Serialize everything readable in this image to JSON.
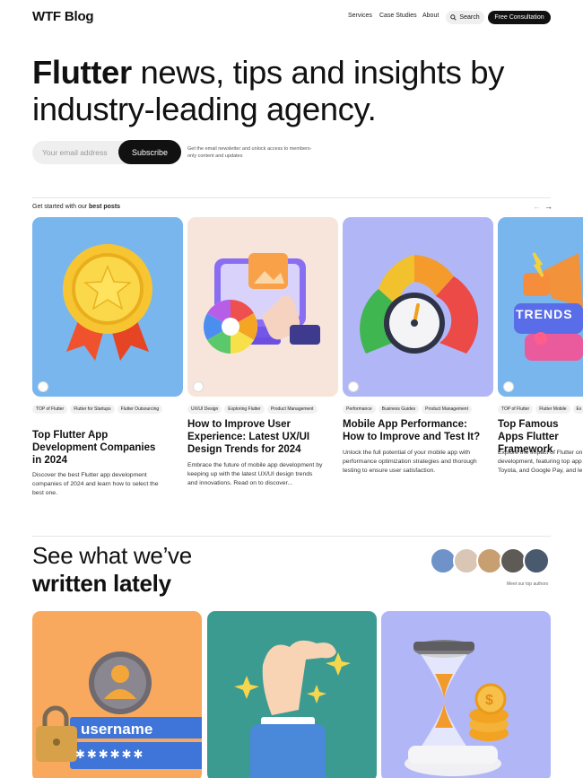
{
  "header": {
    "logo": "WTF Blog",
    "nav": [
      "Services",
      "Case Studies",
      "About"
    ],
    "search_label": "Search",
    "cta_label": "Free Consultation"
  },
  "hero": {
    "title_bold": "Flutter",
    "title_rest": " news, tips and insights by industry-leading agency."
  },
  "newsletter": {
    "email_placeholder": "Your email address",
    "subscribe_label": "Subscribe",
    "note": "Get the email newsletter and unlock access to members-only content and updates"
  },
  "best_posts": {
    "lead_text": "Get started with our ",
    "lead_bold": "best posts",
    "prev_arrow": "←",
    "next_arrow": "→",
    "cards": [
      {
        "tags": [
          "TOP of Flutter",
          "Flutter for Startups",
          "Flutter Outsourcing"
        ],
        "title": "Top Flutter App Development Companies in 2024",
        "description": "Discover the best Flutter app development companies of 2024 and learn how to select the best one.",
        "bg": "#79b6ee"
      },
      {
        "tags": [
          "UX/UI Design",
          "Exploring Flutter",
          "Product Management"
        ],
        "title": "How to Improve User Experience: Latest UX/UI Design Trends for 2024",
        "description": "Embrace the future of mobile app development by keeping up with the latest UX/UI design trends and innovations. Read on to discover...",
        "bg": "#f7e4da"
      },
      {
        "tags": [
          "Performance",
          "Business Guides",
          "Product Management"
        ],
        "title": "Mobile App Performance: How to Improve and Test It?",
        "description": "Unlock the full potential of your mobile app with performance optimization strategies and thorough testing to ensure user satisfaction.",
        "bg": "#b1b7f6"
      },
      {
        "tags": [
          "TOP of Flutter",
          "Flutter Mobile",
          "Ex"
        ],
        "title": "Top Famous Apps Flutter Framework",
        "description": "Explore the impact of Flutter on development, featuring top app Toyota, and Google Pay, and le",
        "bg": "#79b6ee"
      }
    ]
  },
  "lately": {
    "line1": "See what we’ve",
    "line2": "written lately",
    "authors_caption": "Meet our top authors"
  },
  "latest_cards": [
    {
      "bg": "#f8a95e",
      "illustration_text": "username",
      "password_mask": "✱✱✱✱✱✱"
    },
    {
      "bg": "#3b9b91"
    },
    {
      "bg": "#b1b7f6"
    }
  ],
  "icons": [
    "search-icon",
    "arrow-left-icon",
    "arrow-right-icon",
    "medal-icon",
    "monitor-icon",
    "gauge-icon",
    "megaphone-icon",
    "user-lock-icon",
    "hand-icon",
    "hourglass-icon"
  ]
}
